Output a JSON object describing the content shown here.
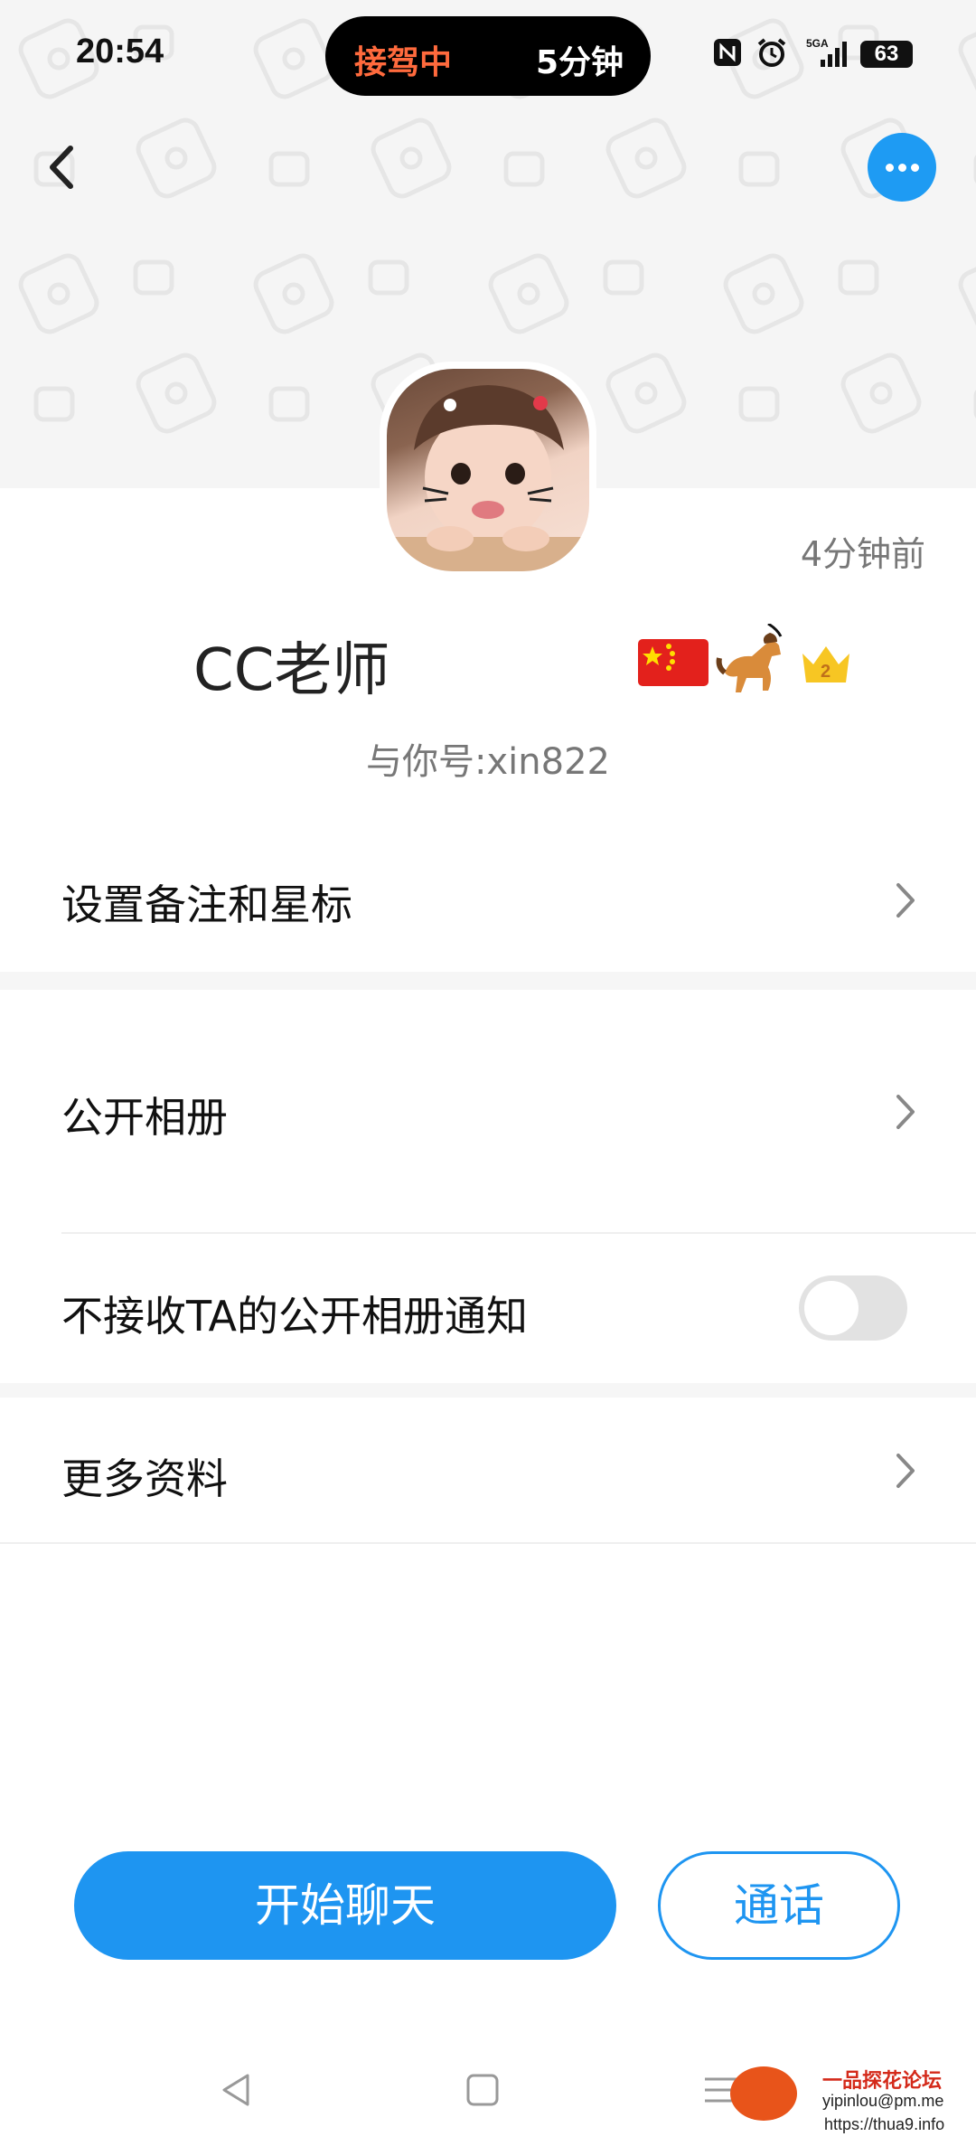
{
  "status_bar": {
    "time": "20:54",
    "live_activity_left": "接驾中",
    "live_activity_right": "5分钟",
    "network_label": "5GA",
    "battery": "63"
  },
  "profile": {
    "last_seen": "4分钟前",
    "name": "CC老师",
    "account": "与你号:xin822",
    "badge_icons": [
      "china-flag-icon",
      "horse-icon",
      "crown-icon"
    ],
    "crown_level": "2"
  },
  "menu": {
    "set_remark_label": "设置备注和星标",
    "public_album_label": "公开相册",
    "mute_album_label": "不接收TA的公开相册通知",
    "mute_album_on": false,
    "more_info_label": "更多资料"
  },
  "actions": {
    "chat_label": "开始聊天",
    "call_label": "通话"
  },
  "watermark": {
    "title": "一品探花论坛",
    "email": "yipinlou@pm.me",
    "url": "https://thua9.info"
  },
  "colors": {
    "accent": "#1e95f1",
    "live_activity_text": "#ff6a3d"
  }
}
